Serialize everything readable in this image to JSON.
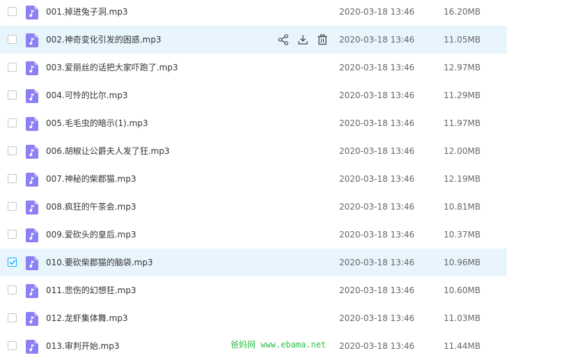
{
  "files": [
    {
      "name": "001.掉进兔子洞.mp3",
      "date": "2020-03-18 13:46",
      "size": "16.20MB",
      "state": "normal"
    },
    {
      "name": "002.神奇变化引发的困惑.mp3",
      "date": "2020-03-18 13:46",
      "size": "11.05MB",
      "state": "hover"
    },
    {
      "name": "003.爱丽丝的话把大家吓跑了.mp3",
      "date": "2020-03-18 13:46",
      "size": "12.97MB",
      "state": "normal"
    },
    {
      "name": "004.可怜的比尔.mp3",
      "date": "2020-03-18 13:46",
      "size": "11.29MB",
      "state": "normal"
    },
    {
      "name": "005.毛毛虫的暗示(1).mp3",
      "date": "2020-03-18 13:46",
      "size": "11.97MB",
      "state": "normal"
    },
    {
      "name": "006.胡椒让公爵夫人发了狂.mp3",
      "date": "2020-03-18 13:46",
      "size": "12.00MB",
      "state": "normal"
    },
    {
      "name": "007.神秘的柴郡猫.mp3",
      "date": "2020-03-18 13:46",
      "size": "12.19MB",
      "state": "normal"
    },
    {
      "name": "008.疯狂的午茶会.mp3",
      "date": "2020-03-18 13:46",
      "size": "10.81MB",
      "state": "normal"
    },
    {
      "name": "009.爱砍头的皇后.mp3",
      "date": "2020-03-18 13:46",
      "size": "10.37MB",
      "state": "normal"
    },
    {
      "name": "010.要砍柴郡猫的脑袋.mp3",
      "date": "2020-03-18 13:46",
      "size": "10.96MB",
      "state": "selected"
    },
    {
      "name": "011.悲伤的幻想狂.mp3",
      "date": "2020-03-18 13:46",
      "size": "10.60MB",
      "state": "normal"
    },
    {
      "name": "012.龙虾集体舞.mp3",
      "date": "2020-03-18 13:46",
      "size": "11.03MB",
      "state": "normal"
    },
    {
      "name": "013.审判开始.mp3",
      "date": "2020-03-18 13:46",
      "size": "11.44MB",
      "state": "normal"
    }
  ],
  "row_actions": {
    "share_icon": "share-icon",
    "download_icon": "download-icon",
    "delete_icon": "trash-icon"
  },
  "watermark": "爸妈网 www.ebama.net",
  "colors": {
    "hover_bg": "#e8f5fd",
    "icon_purple": "#8c80f2",
    "checkbox_checked": "#06a7ff",
    "watermark": "#2fbf4a"
  }
}
